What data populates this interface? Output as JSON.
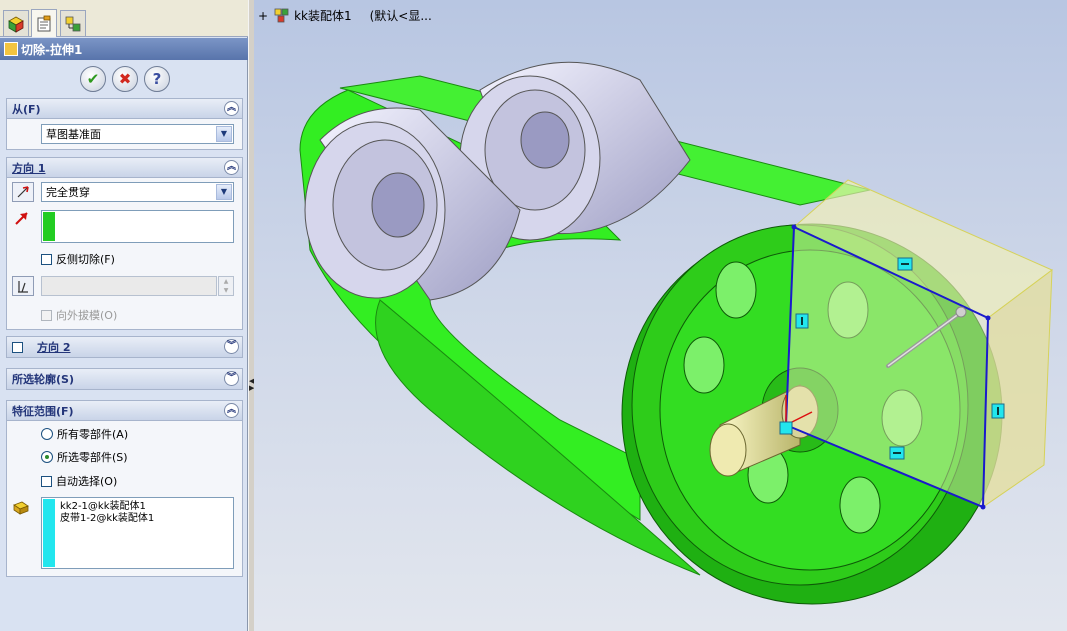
{
  "feature": {
    "title": "切除-拉伸1",
    "ok_symbol": "✔",
    "cancel_symbol": "✖",
    "help_symbol": "?"
  },
  "from_group": {
    "title": "从(F)",
    "value": "草图基准面"
  },
  "direction1": {
    "title": "方向 1",
    "end_condition": "完全贯穿",
    "flip_side_label": "反侧切除(F)",
    "draft_label": "向外拔模(O)"
  },
  "direction2": {
    "title": "方向 2"
  },
  "contours": {
    "title": "所选轮廓(S)"
  },
  "feature_scope": {
    "title": "特征范围(F)",
    "all_components_label": "所有零部件(A)",
    "selected_components_label": "所选零部件(S)",
    "auto_select_label": "自动选择(O)",
    "selected": "selected_components",
    "components": [
      "kk2-1@kk装配体1",
      "皮带1-2@kk装配体1"
    ]
  },
  "viewport": {
    "expand_symbol": "+",
    "assembly_name": "kk装配体1",
    "configuration": "(默认<显..."
  },
  "colors": {
    "belt": "#33ee22",
    "pulley": "#2ecc1a",
    "roller": "#d6d6ec",
    "shaft": "#e6e29a",
    "cut_box": "#f2f1b6",
    "sketch": "#1a1acc"
  },
  "icons": {
    "feature_manager_tab": "feature-tree-icon",
    "property_manager_tab": "property-manager-icon",
    "configuration_manager_tab": "configuration-icon",
    "reverse_direction": "reverse-direction-icon",
    "direction_vector": "direction-arrow-icon",
    "draft": "draft-icon",
    "components": "component-icon"
  }
}
